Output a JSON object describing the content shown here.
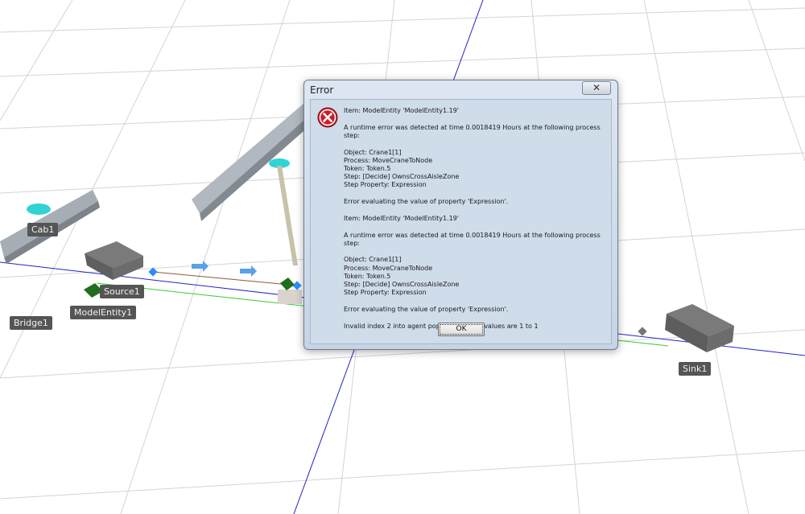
{
  "scene": {
    "labels": {
      "cab1": "Cab1",
      "source1": "Source1",
      "model_entity1": "ModelEntity1",
      "bridge1": "Bridge1",
      "sink1": "Sink1"
    }
  },
  "dialog": {
    "title": "Error",
    "close_glyph": "✕",
    "icon": "error-icon",
    "messages": [
      {
        "item": "Item: ModelEntity 'ModelEntity1.19'",
        "detected": "A runtime error was detected at time 0.0018419 Hours at the following process step:",
        "object": "Object: Crane1[1]",
        "process": "Process: MoveCraneToNode",
        "token": "Token: Token.5",
        "step": "Step: [Decide] OwnsCrossAisleZone",
        "step_property": "Step Property: Expression",
        "error": "Error evaluating the value of property 'Expression'."
      },
      {
        "item": "Item: ModelEntity 'ModelEntity1.19'",
        "detected": "A runtime error was detected at time 0.0018419 Hours at the following process step:",
        "object": "Object: Crane1[1]",
        "process": "Process: MoveCraneToNode",
        "token": "Token: Token.5",
        "step": "Step: [Decide] OwnsCrossAisleZone",
        "step_property": "Step Property: Expression",
        "error": "Error evaluating the value of property 'Expression'."
      }
    ],
    "final_message": "Invalid index 2 into agent population. Valid values are 1 to 1",
    "ok_label": "OK"
  }
}
